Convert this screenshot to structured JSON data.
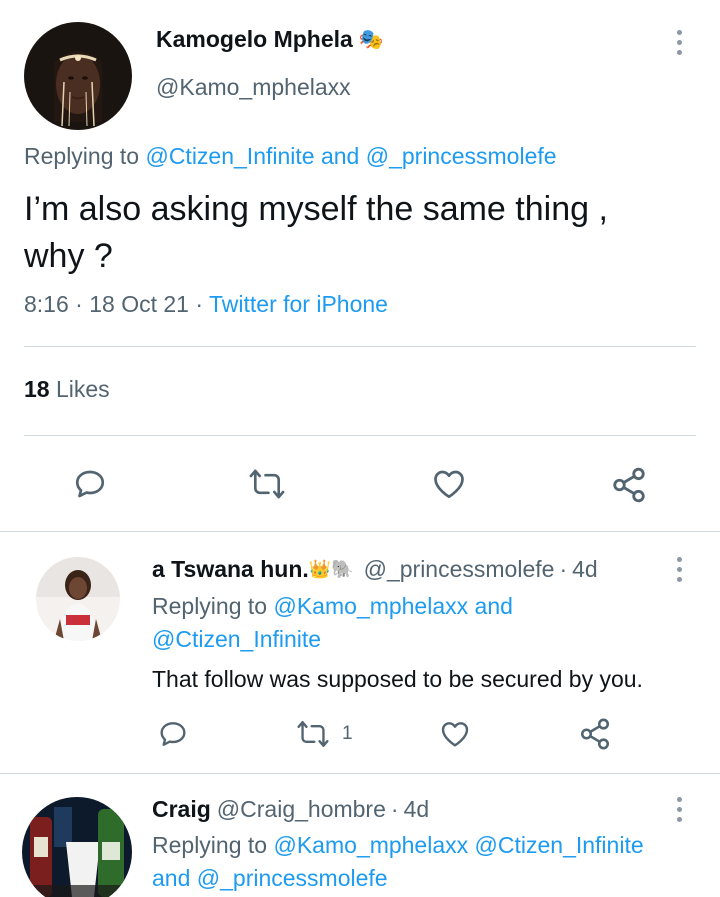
{
  "main_tweet": {
    "author_name": "Kamogelo Mphela",
    "author_handle": "@Kamo_mphelaxx",
    "replying_prefix": "Replying to",
    "replying_to_1": "@Ctizen_Infinite",
    "replying_and": "and",
    "replying_to_2": "@_princessmolefe",
    "text_line1": "I’m also asking myself the same thing ,",
    "text_line2": "why ?",
    "time": "8:16",
    "date": "18 Oct 21",
    "source": "Twitter for iPhone",
    "likes_count": "18",
    "likes_label": "Likes",
    "name_emoji": "🎭",
    "colors": {
      "link": "#1d9bf0",
      "secondary": "#536471",
      "divider": "#cfd9de"
    }
  },
  "replies": [
    {
      "author_name": "a Tswana hun.",
      "name_emojis": "👑🐘",
      "author_handle": "@_princessmolefe",
      "age": "4d",
      "replying_prefix": "Replying to",
      "replying_to_1": "@Kamo_mphelaxx",
      "replying_and": "and",
      "replying_to_2": "@Ctizen_Infinite",
      "text": "That follow was supposed to be secured by you.",
      "retweet_count": "1"
    },
    {
      "author_name": "Craig",
      "author_handle": "@Craig_hombre",
      "age": "4d",
      "replying_prefix": "Replying to",
      "replying_to_1": "@Kamo_mphelaxx",
      "replying_to_2": "@Ctizen_Infinite",
      "replying_and": "and",
      "replying_to_3": "@_princessmolefe"
    }
  ],
  "icons": [
    "reply-icon",
    "retweet-icon",
    "like-icon",
    "share-icon",
    "more-options-icon"
  ]
}
